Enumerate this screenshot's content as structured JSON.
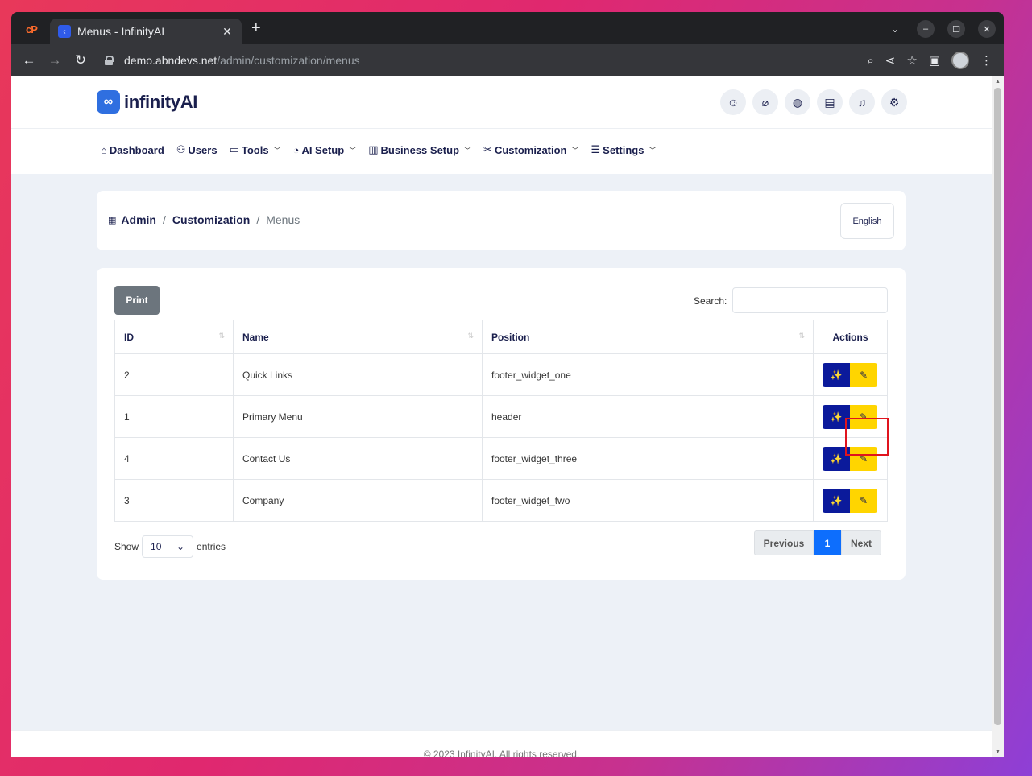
{
  "browser": {
    "tab_title": "Menus - InfinityAI",
    "new_tab": "+",
    "url_host": "demo.abndevs.net",
    "url_path": "/admin/customization/menus"
  },
  "site": {
    "logo_mark": "∞",
    "logo_text": "infinityAI"
  },
  "nav": {
    "items": [
      {
        "label": "Dashboard",
        "icon": "home-icon",
        "dropdown": false
      },
      {
        "label": "Users",
        "icon": "users-icon",
        "dropdown": false
      },
      {
        "label": "Tools",
        "icon": "toolbox-icon",
        "dropdown": true
      },
      {
        "label": "AI Setup",
        "icon": "gauge-icon",
        "dropdown": true
      },
      {
        "label": "Business Setup",
        "icon": "building-icon",
        "dropdown": true
      },
      {
        "label": "Customization",
        "icon": "tools-icon",
        "dropdown": true
      },
      {
        "label": "Settings",
        "icon": "sliders-icon",
        "dropdown": true
      }
    ]
  },
  "breadcrumb": {
    "admin": "Admin",
    "customization": "Customization",
    "current": "Menus",
    "sep": "/"
  },
  "language": "English",
  "table": {
    "print_label": "Print",
    "search_label": "Search:",
    "columns": [
      "ID",
      "Name",
      "Position",
      "Actions"
    ],
    "rows": [
      {
        "id": "2",
        "name": "Quick Links",
        "position": "footer_widget_one"
      },
      {
        "id": "1",
        "name": "Primary Menu",
        "position": "header"
      },
      {
        "id": "4",
        "name": "Contact Us",
        "position": "footer_widget_three"
      },
      {
        "id": "3",
        "name": "Company",
        "position": "footer_widget_two"
      }
    ],
    "show_label": "Show",
    "page_size": "10",
    "entries_label": "entries",
    "pagination": {
      "previous": "Previous",
      "current": "1",
      "next": "Next"
    }
  },
  "footer": "© 2023 InfinityAI. All rights reserved.",
  "colors": {
    "brand_navy": "#1a1f4d",
    "magic_button": "#0b1a9b",
    "edit_button": "#ffd500",
    "page_active": "#0d6efd",
    "highlight": "#e0141e"
  }
}
